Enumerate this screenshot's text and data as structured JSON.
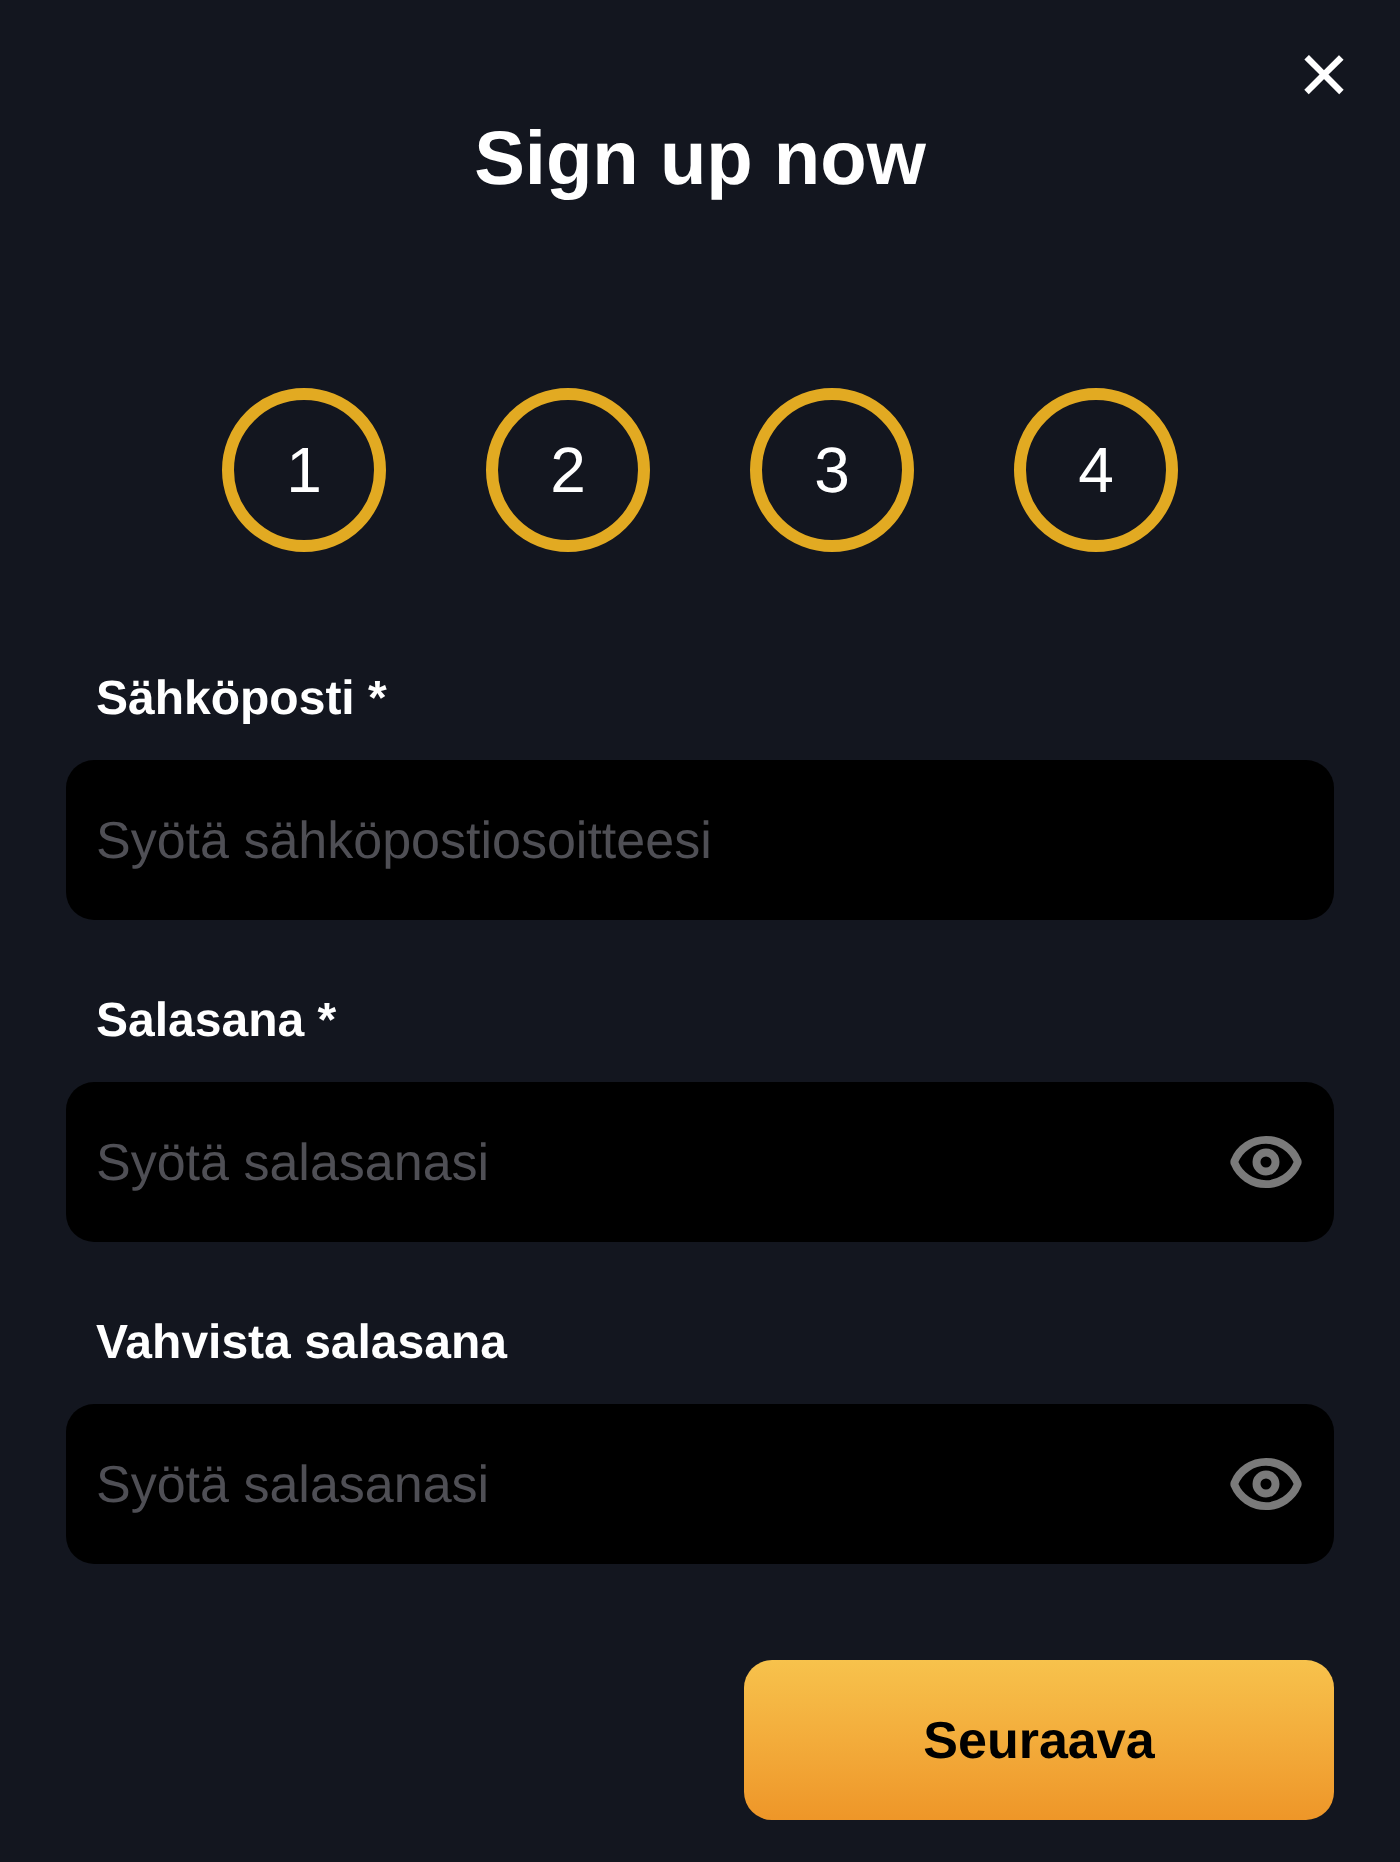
{
  "close": "×",
  "title": "Sign up now",
  "steps": [
    {
      "label": "1"
    },
    {
      "label": "2"
    },
    {
      "label": "3"
    },
    {
      "label": "4"
    }
  ],
  "fields": [
    {
      "kind": "email",
      "label": "Sähköposti *",
      "placeholder": "Syötä sähköpostiosoitteesi"
    },
    {
      "kind": "password",
      "label": "Salasana *",
      "placeholder": "Syötä salasanasi"
    },
    {
      "kind": "password",
      "label": "Vahvista salasana",
      "placeholder": "Syötä salasanasi"
    }
  ],
  "button": "Seuraava"
}
